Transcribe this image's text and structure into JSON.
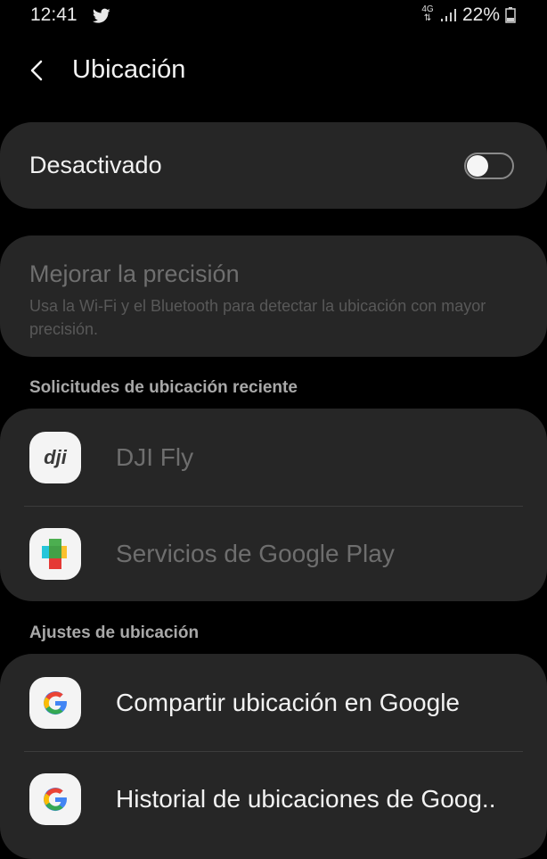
{
  "status_bar": {
    "time": "12:41",
    "network": "4G",
    "battery": "22%"
  },
  "header": {
    "title": "Ubicación"
  },
  "location_toggle": {
    "label": "Desactivado",
    "state": "off"
  },
  "precision": {
    "title": "Mejorar la precisión",
    "description": "Usa la Wi-Fi y el Bluetooth para detectar la ubicación con mayor precisión."
  },
  "recent_requests": {
    "header": "Solicitudes de ubicación reciente",
    "items": [
      {
        "label": "DJI Fly",
        "icon": "dji-fly-app-icon"
      },
      {
        "label": "Servicios de Google Play",
        "icon": "google-play-services-icon"
      }
    ]
  },
  "location_settings": {
    "header": "Ajustes de ubicación",
    "items": [
      {
        "label": "Compartir ubicación en Google",
        "icon": "google-g-icon"
      },
      {
        "label": "Historial de ubicaciones de Goog..",
        "icon": "google-g-icon"
      }
    ]
  },
  "colors": {
    "background": "#000000",
    "card": "#262626",
    "text_primary": "#f2f2f2",
    "text_disabled": "#6e6e6e",
    "section_header": "#a8a8a8"
  }
}
